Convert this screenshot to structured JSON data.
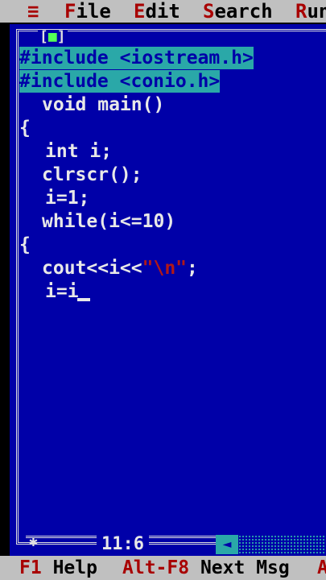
{
  "menu": {
    "system": "≡",
    "file": "File",
    "edit": "Edit",
    "search": "Search",
    "run": "Run"
  },
  "window": {
    "close_box": "[■]"
  },
  "code": {
    "line1": "#include <iostream.h>",
    "line2": "#include <conio.h>",
    "line3": "void main()",
    "line4": "{",
    "line5": "int i;",
    "line6": "clrscr();",
    "line7": "i=1;",
    "line8": "while(i<=10)",
    "line9": "{",
    "line10_pre": "cout<<i<<",
    "line10_str": "\"\\n\"",
    "line10_post": ";",
    "line11": "i=i"
  },
  "status": {
    "position": "11:6",
    "scroll_icon": "◄"
  },
  "fkeys": [
    {
      "key": "F1",
      "label": "Help"
    },
    {
      "key": "Alt-F8",
      "label": "Next Msg"
    },
    {
      "key": "A",
      "label": ""
    }
  ],
  "colors": {
    "editor_bg": "#0000a8",
    "menu_bg": "#c0c0c0",
    "highlight_bg": "#2aa8a8",
    "hotkey": "#a80000",
    "string": "#b01818"
  }
}
